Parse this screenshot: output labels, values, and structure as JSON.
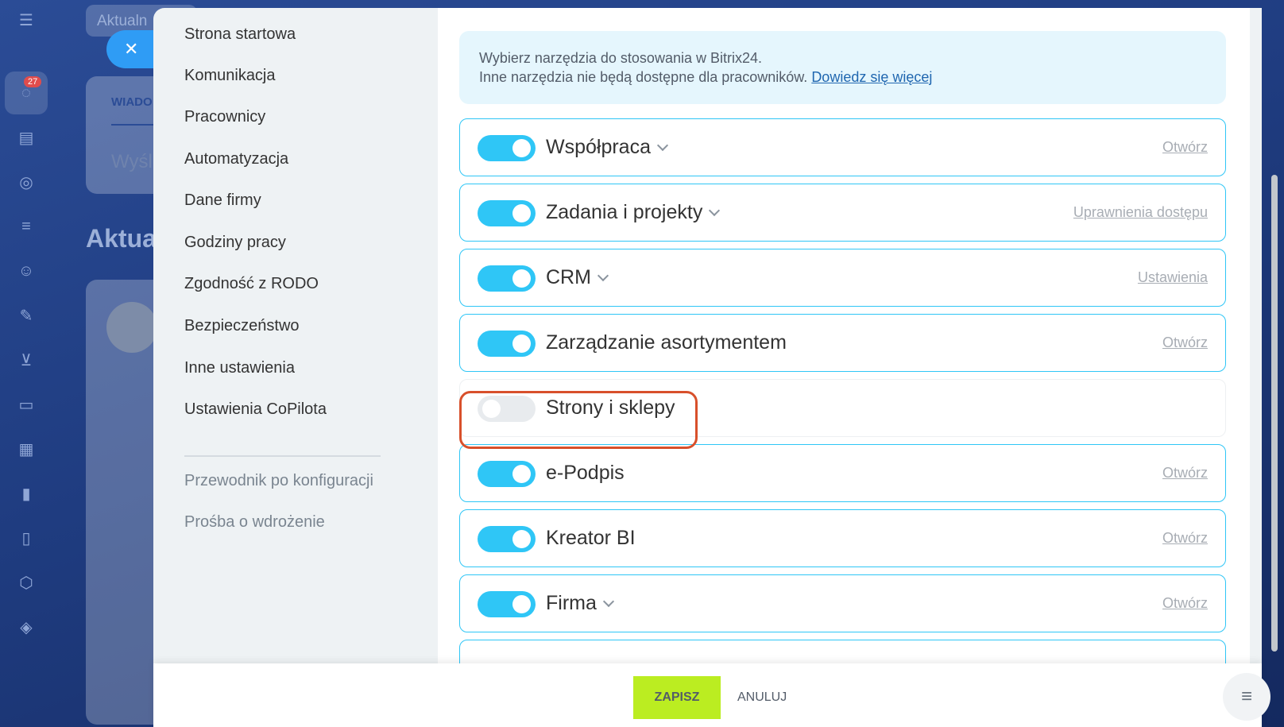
{
  "background": {
    "search_text": "Aktualn",
    "tab_label": "WIADO",
    "card_text": "Wyśl",
    "heading": "Aktua",
    "notification_count": "27"
  },
  "nav": {
    "items": [
      {
        "label": "Strona startowa"
      },
      {
        "label": "Komunikacja"
      },
      {
        "label": "Pracownicy"
      },
      {
        "label": "Automatyzacja"
      },
      {
        "label": "Dane firmy"
      },
      {
        "label": "Godziny pracy"
      },
      {
        "label": "Zgodność z RODO"
      },
      {
        "label": "Bezpieczeństwo"
      },
      {
        "label": "Inne ustawienia"
      },
      {
        "label": "Ustawienia CoPilota"
      }
    ],
    "secondary": [
      {
        "label": "Przewodnik po konfiguracji"
      },
      {
        "label": "Prośba o wdrożenie"
      }
    ]
  },
  "info": {
    "line1": "Wybierz narzędzia do stosowania w Bitrix24.",
    "line2": "Inne narzędzia nie będą dostępne dla pracowników.",
    "link": "Dowiedz się więcej"
  },
  "tools": [
    {
      "name": "Współpraca",
      "enabled": true,
      "expandable": true,
      "action": "Otwórz"
    },
    {
      "name": "Zadania i projekty",
      "enabled": true,
      "expandable": true,
      "action": "Uprawnienia dostępu"
    },
    {
      "name": "CRM",
      "enabled": true,
      "expandable": true,
      "action": "Ustawienia"
    },
    {
      "name": "Zarządzanie asortymentem",
      "enabled": true,
      "expandable": false,
      "action": "Otwórz"
    },
    {
      "name": "Strony i sklepy",
      "enabled": false,
      "expandable": false,
      "action": ""
    },
    {
      "name": "e-Podpis",
      "enabled": true,
      "expandable": false,
      "action": "Otwórz"
    },
    {
      "name": "Kreator BI",
      "enabled": true,
      "expandable": false,
      "action": "Otwórz"
    },
    {
      "name": "Firma",
      "enabled": true,
      "expandable": true,
      "action": "Otwórz"
    }
  ],
  "footer": {
    "save_label": "ZAPISZ",
    "cancel_label": "ANULUJ"
  },
  "colors": {
    "accent": "#2fc6f6",
    "save": "#bbed21",
    "highlight": "#d8502b"
  }
}
